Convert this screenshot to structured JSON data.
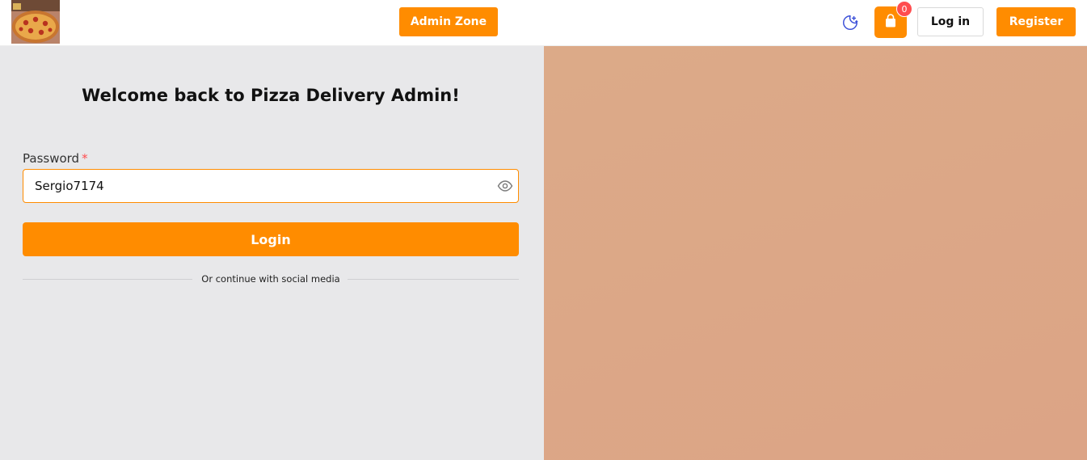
{
  "header": {
    "logo_alt": "Pizza",
    "admin_zone_label": "Admin Zone",
    "theme_icon": "moon-stars-icon",
    "cart": {
      "icon": "shopping-bag-icon",
      "count": "0"
    },
    "login_label": "Log in",
    "register_label": "Register"
  },
  "form": {
    "title": "Welcome back to Pizza Delivery Admin!",
    "password_label": "Password",
    "required_mark": "*",
    "password_value": "Sergio7174",
    "visibility_icon": "eye-icon",
    "submit_label": "Login",
    "social_divider_text": "Or continue with social media"
  },
  "colors": {
    "accent": "#ff8c00",
    "badge": "#ff4d4f",
    "panel_bg": "#e8e8ea",
    "side_panel": "#dcaa88"
  }
}
